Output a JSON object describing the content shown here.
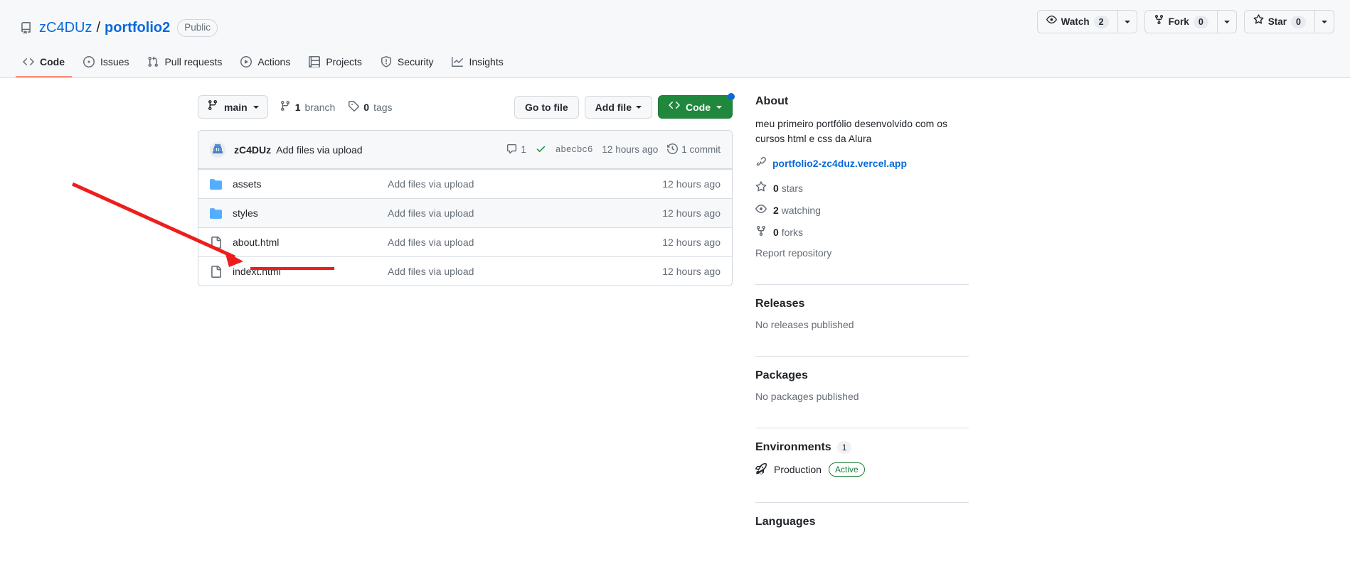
{
  "header": {
    "repo_icon": "repo-icon",
    "owner": "zC4DUz",
    "separator": "/",
    "name": "portfolio2",
    "visibility": "Public",
    "actions": {
      "watch_label": "Watch",
      "watch_count": "2",
      "fork_label": "Fork",
      "fork_count": "0",
      "star_label": "Star",
      "star_count": "0"
    }
  },
  "nav": {
    "tabs": [
      {
        "label": "Code",
        "icon": "code-icon",
        "active": true
      },
      {
        "label": "Issues",
        "icon": "issue-opened-icon",
        "active": false
      },
      {
        "label": "Pull requests",
        "icon": "git-pull-request-icon",
        "active": false
      },
      {
        "label": "Actions",
        "icon": "play-icon",
        "active": false
      },
      {
        "label": "Projects",
        "icon": "table-icon",
        "active": false
      },
      {
        "label": "Security",
        "icon": "shield-icon",
        "active": false
      },
      {
        "label": "Insights",
        "icon": "graph-icon",
        "active": false
      }
    ]
  },
  "toolbar": {
    "branch_name": "main",
    "branch_count": "1",
    "branch_word": "branch",
    "tag_count": "0",
    "tag_word": "tags",
    "go_to_file": "Go to file",
    "add_file": "Add file",
    "code_label": "Code"
  },
  "commit_bar": {
    "author": "zC4DUz",
    "message": "Add files via upload",
    "comment_count": "1",
    "sha": "abecbc6",
    "time": "12 hours ago",
    "commit_count_label": "1 commit"
  },
  "files": [
    {
      "name": "assets",
      "type": "directory",
      "commit": "Add files via upload",
      "time": "12 hours ago"
    },
    {
      "name": "styles",
      "type": "directory",
      "commit": "Add files via upload",
      "time": "12 hours ago"
    },
    {
      "name": "about.html",
      "type": "file",
      "commit": "Add files via upload",
      "time": "12 hours ago"
    },
    {
      "name": "indext.html",
      "type": "file",
      "commit": "Add files via upload",
      "time": "12 hours ago"
    }
  ],
  "sidebar": {
    "about_title": "About",
    "description": "meu primeiro portfólio desenvolvido com os cursos html e css da Alura",
    "homepage": "portfolio2-zc4duz.vercel.app",
    "stars": "0",
    "stars_label": "stars",
    "watching": "2",
    "watching_label": "watching",
    "forks": "0",
    "forks_label": "forks",
    "report": "Report repository",
    "releases_title": "Releases",
    "releases_empty": "No releases published",
    "packages_title": "Packages",
    "packages_empty": "No packages published",
    "environments_title": "Environments",
    "environments_count": "1",
    "environment_name": "Production",
    "environment_status": "Active",
    "languages_title": "Languages"
  },
  "annotation": {
    "color": "#ee1d1d",
    "target": "indext.html"
  }
}
